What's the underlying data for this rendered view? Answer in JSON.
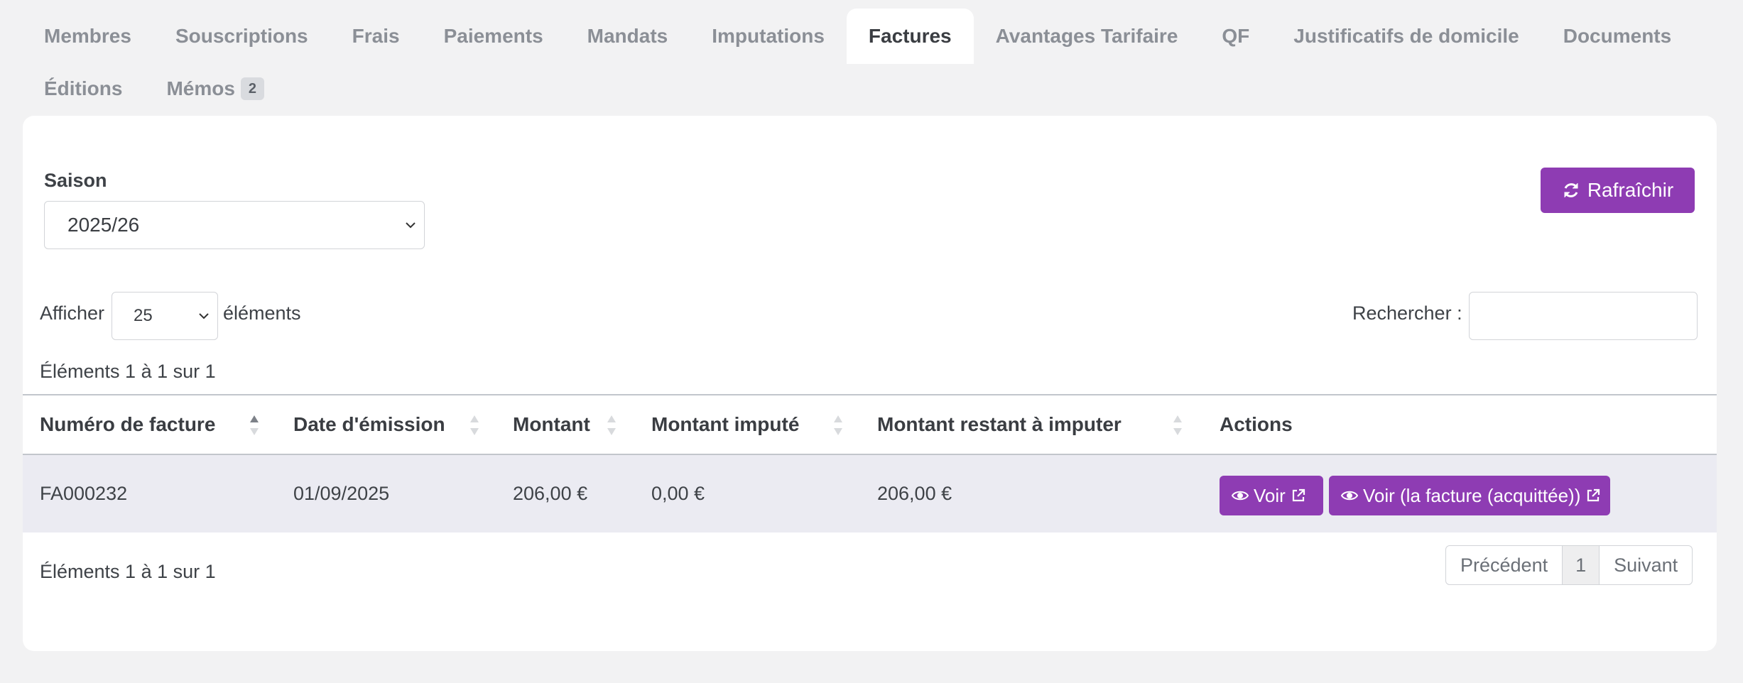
{
  "tabs": {
    "row1": [
      "Membres",
      "Souscriptions",
      "Frais",
      "Paiements",
      "Mandats",
      "Imputations",
      "Factures",
      "Avantages Tarifaire",
      "QF",
      "Justificatifs de domicile",
      "Documents"
    ],
    "row2": [
      "Éditions",
      "Mémos"
    ],
    "active": "Factures",
    "memos_badge": "2"
  },
  "filters": {
    "saison_label": "Saison",
    "saison_value": "2025/26",
    "refresh_label": "Rafraîchir"
  },
  "table_controls": {
    "show_label": "Afficher",
    "page_length": "25",
    "elements_label": "éléments",
    "search_label": "Rechercher :",
    "search_value": "",
    "info_top": "Éléments 1 à 1 sur 1",
    "info_bottom": "Éléments 1 à 1 sur 1"
  },
  "table": {
    "columns": [
      "Numéro de facture",
      "Date d'émission",
      "Montant",
      "Montant imputé",
      "Montant restant à imputer",
      "Actions"
    ],
    "rows": [
      {
        "numero": "FA000232",
        "date": "01/09/2025",
        "montant": "206,00 €",
        "montant_impute": "0,00 €",
        "montant_restant": "206,00 €",
        "actions": [
          "Voir",
          "Voir (la facture (acquittée))"
        ]
      }
    ]
  },
  "pagination": {
    "previous": "Précédent",
    "current": "1",
    "next": "Suivant"
  },
  "colors": {
    "accent": "#8e3cb3",
    "page_bg": "#f2f2f3",
    "row_bg": "#ebebf2"
  }
}
